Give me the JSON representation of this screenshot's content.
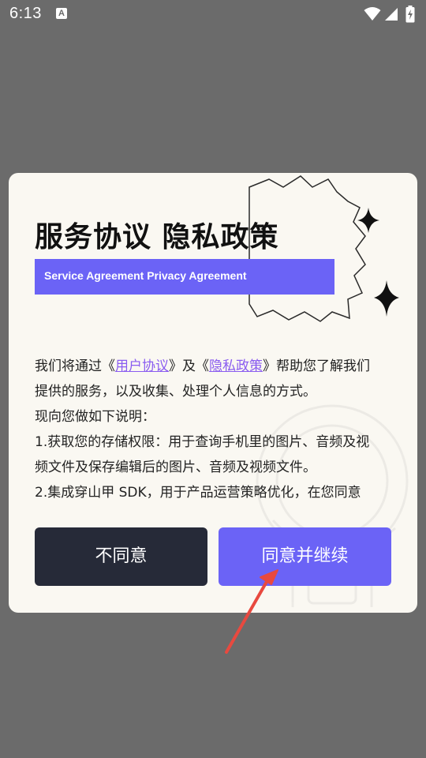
{
  "status_bar": {
    "time": "6:13",
    "notification_icon": "a-notification-icon",
    "wifi_icon": "wifi-icon",
    "signal_icon": "signal-icon",
    "battery_icon": "battery-charging-icon",
    "notification_letter": "A"
  },
  "dialog": {
    "title": "服务协议 隐私政策",
    "subtitle": "Service Agreement Privacy Agreement",
    "accent_color": "#6b63f6",
    "body": {
      "line1_prefix": "我们将通过《",
      "link_user_agreement": "用户协议",
      "line1_mid": "》及《",
      "link_privacy_policy": "隐私政策",
      "line1_suffix": "》帮助您了解我们",
      "line2": "提供的服务，以及收集、处理个人信息的方式。",
      "line3": "现向您做如下说明：",
      "line4": "1.获取您的存储权限：用于查询手机里的图片、音频及视",
      "line5": "频文件及保存编辑后的图片、音频及视频文件。",
      "line6": "2.集成穿山甲 SDK，用于产品运营策略优化，在您同意"
    },
    "buttons": {
      "disagree": "不同意",
      "agree": "同意并继续"
    }
  }
}
